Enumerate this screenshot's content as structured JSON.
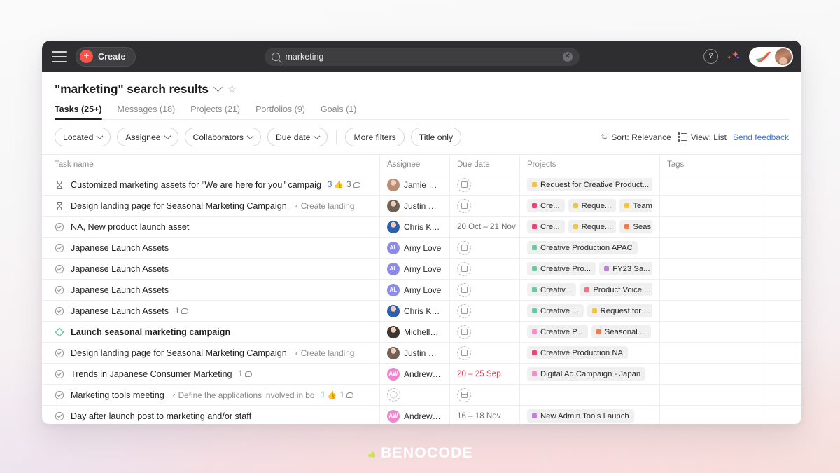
{
  "topbar": {
    "menu_icon": "hamburger-icon",
    "create_label": "Create",
    "search_value": "marketing",
    "search_placeholder": "Search",
    "help_label": "?",
    "clear_label": "✕"
  },
  "header": {
    "title": "\"marketing\" search results",
    "star_glyph": "☆",
    "tabs": [
      {
        "label": "Tasks (25+)",
        "active": true
      },
      {
        "label": "Messages (18)",
        "active": false
      },
      {
        "label": "Projects (21)",
        "active": false
      },
      {
        "label": "Portfolios (9)",
        "active": false
      },
      {
        "label": "Goals (1)",
        "active": false
      }
    ]
  },
  "filters": {
    "pills": [
      "Located",
      "Assignee",
      "Collaborators",
      "Due date"
    ],
    "more_filters": "More filters",
    "title_only": "Title only",
    "sort": "Sort: Relevance",
    "view": "View: List",
    "feedback": "Send feedback"
  },
  "table": {
    "columns": [
      "Task name",
      "Assignee",
      "Due date",
      "Projects",
      "Tags",
      ""
    ],
    "rows": [
      {
        "status": "hourglass",
        "name": "Customized marketing assets for \"We are here for you\" campaig",
        "subtitle": "",
        "likes": "3",
        "comments": "3",
        "assignee": {
          "name": "Jamie Stapl...",
          "initials": "JS",
          "type": "photo",
          "color": "#b98c74"
        },
        "due": "",
        "due_overdue": false,
        "projects": [
          {
            "label": "Request for Creative Product...",
            "color": "#f1c44a"
          }
        ],
        "tags": ""
      },
      {
        "status": "hourglass",
        "name": "Design landing page for Seasonal Marketing Campaign",
        "subtitle": "Create landing",
        "likes": "",
        "comments": "",
        "assignee": {
          "name": "Justin Dean",
          "initials": "JD",
          "type": "photo",
          "color": "#6f6156"
        },
        "due": "",
        "due_overdue": false,
        "projects": [
          {
            "label": "Cre...",
            "color": "#e8457f"
          },
          {
            "label": "Reque...",
            "color": "#f1c44a"
          },
          {
            "label": "Team...",
            "color": "#f1c44a"
          }
        ],
        "tags": ""
      },
      {
        "status": "check",
        "name": "NA, New product launch asset",
        "subtitle": "",
        "likes": "",
        "comments": "",
        "assignee": {
          "name": "Chris Krutz...",
          "initials": "CK",
          "type": "photo",
          "color": "#2f5fa8"
        },
        "due": "20 Oct – 21 Nov",
        "due_overdue": false,
        "projects": [
          {
            "label": "Cre...",
            "color": "#e8457f"
          },
          {
            "label": "Reque...",
            "color": "#f1c44a"
          },
          {
            "label": "Seas...",
            "color": "#ec7d52"
          }
        ],
        "tags": ""
      },
      {
        "status": "check",
        "name": "Japanese Launch Assets",
        "subtitle": "",
        "likes": "",
        "comments": "",
        "assignee": {
          "name": "Amy Love",
          "initials": "AL",
          "type": "initials",
          "color": "#8c8ce8"
        },
        "due": "",
        "due_overdue": false,
        "projects": [
          {
            "label": "Creative Production APAC",
            "color": "#6cc8a0"
          }
        ],
        "tags": ""
      },
      {
        "status": "check",
        "name": "Japanese Launch Assets",
        "subtitle": "",
        "likes": "",
        "comments": "",
        "assignee": {
          "name": "Amy Love",
          "initials": "AL",
          "type": "initials",
          "color": "#8c8ce8"
        },
        "due": "",
        "due_overdue": false,
        "projects": [
          {
            "label": "Creative Pro...",
            "color": "#6cc8a0"
          },
          {
            "label": "FY23 Sa...",
            "color": "#c07ce0"
          }
        ],
        "tags": ""
      },
      {
        "status": "check",
        "name": "Japanese Launch Assets",
        "subtitle": "",
        "likes": "",
        "comments": "",
        "assignee": {
          "name": "Amy Love",
          "initials": "AL",
          "type": "initials",
          "color": "#8c8ce8"
        },
        "due": "",
        "due_overdue": false,
        "projects": [
          {
            "label": "Creativ...",
            "color": "#6cc8a0"
          },
          {
            "label": "Product Voice ...",
            "color": "#f4717f"
          }
        ],
        "tags": ""
      },
      {
        "status": "check",
        "name": "Japanese Launch Assets",
        "subtitle": "",
        "likes": "",
        "comments": "1",
        "assignee": {
          "name": "Chris Krutz...",
          "initials": "CK",
          "type": "photo",
          "color": "#2f5fa8"
        },
        "due": "",
        "due_overdue": false,
        "projects": [
          {
            "label": "Creative ...",
            "color": "#6cc8a0"
          },
          {
            "label": "Request for ...",
            "color": "#f1c44a"
          }
        ],
        "tags": ""
      },
      {
        "status": "milestone",
        "name": "Launch seasonal marketing campaign",
        "bold": true,
        "subtitle": "",
        "likes": "",
        "comments": "",
        "assignee": {
          "name": "Michelle We...",
          "initials": "MW",
          "type": "photo",
          "color": "#3c3530"
        },
        "due": "",
        "due_overdue": false,
        "projects": [
          {
            "label": "Creative P...",
            "color": "#f48fc8"
          },
          {
            "label": "Seasonal ...",
            "color": "#ec7d52"
          }
        ],
        "tags": ""
      },
      {
        "status": "check",
        "name": "Design landing page for Seasonal Marketing Campaign",
        "subtitle": "Create landing",
        "likes": "",
        "comments": "",
        "assignee": {
          "name": "Justin Dean",
          "initials": "JD",
          "type": "photo",
          "color": "#6f6156"
        },
        "due": "",
        "due_overdue": false,
        "projects": [
          {
            "label": "Creative Production NA",
            "color": "#e8457f"
          }
        ],
        "tags": ""
      },
      {
        "status": "check",
        "name": "Trends in Japanese Consumer Marketing",
        "subtitle": "",
        "likes": "",
        "comments": "1",
        "assignee": {
          "name": "Andrew We...",
          "initials": "AW",
          "type": "initials",
          "color": "#ed86cc"
        },
        "due": "20 – 25 Sep",
        "due_overdue": true,
        "projects": [
          {
            "label": "Digital Ad Campaign - Japan",
            "color": "#f48fc8"
          }
        ],
        "tags": ""
      },
      {
        "status": "check",
        "name": "Marketing tools meeting",
        "subtitle": "Define the applications involved in bo",
        "likes": "1",
        "comments": "1",
        "assignee": {
          "name": "",
          "initials": "",
          "type": "empty",
          "color": ""
        },
        "due": "",
        "due_overdue": false,
        "projects": [],
        "tags": ""
      },
      {
        "status": "check",
        "name": "Day after launch post to marketing and/or staff",
        "subtitle": "",
        "likes": "",
        "comments": "",
        "assignee": {
          "name": "Andrew We...",
          "initials": "AW",
          "type": "initials",
          "color": "#ed86cc"
        },
        "due": "16 – 18 Nov",
        "due_overdue": false,
        "projects": [
          {
            "label": "New Admin Tools Launch",
            "color": "#c07ce0"
          }
        ],
        "tags": ""
      }
    ]
  },
  "watermark": {
    "text": "BENOCODE"
  }
}
